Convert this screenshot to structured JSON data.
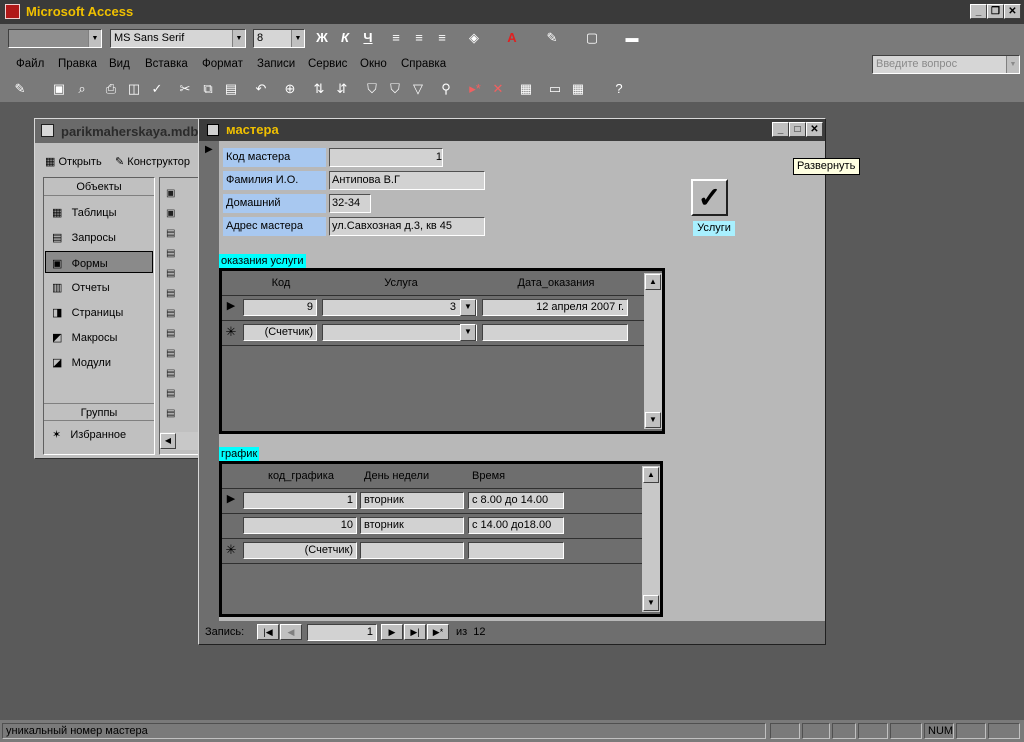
{
  "app": {
    "title": "Microsoft Access"
  },
  "format_toolbar": {
    "object_select": "",
    "font_name": "MS Sans Serif",
    "font_size": "8",
    "bold": "Ж",
    "italic": "К",
    "underline": "Ч"
  },
  "menu": {
    "items": [
      "Файл",
      "Правка",
      "Вид",
      "Вставка",
      "Формат",
      "Записи",
      "Сервис",
      "Окно",
      "Справка"
    ],
    "help_placeholder": "Введите вопрос"
  },
  "db_window": {
    "title": "parikmaherskaya.mdb",
    "open": "Открыть",
    "design": "Конструктор",
    "objects_header": "Объекты",
    "objects": [
      "Таблицы",
      "Запросы",
      "Формы",
      "Отчеты",
      "Страницы",
      "Макросы",
      "Модули"
    ],
    "selected": "Формы",
    "groups_header": "Группы",
    "groups": [
      "Избранное"
    ]
  },
  "form": {
    "title": "мастера",
    "fields": [
      {
        "label": "Код мастера",
        "value": "1"
      },
      {
        "label": "Фамилия И.О.",
        "value": "Антипова  В.Г"
      },
      {
        "label": "Домашний телофон",
        "value": "32-34"
      },
      {
        "label": "Адрес мастера",
        "value": "ул.Савхозная д.3, кв 45"
      }
    ],
    "button_label": "Услуги",
    "tooltip": "Развернуть",
    "subform1": {
      "label": "оказания услуги",
      "headers": [
        "Код",
        "Услуга",
        "Дата_оказания"
      ],
      "rows": [
        {
          "code": "9",
          "service": "3",
          "date": "12 апреля 2007 г."
        }
      ],
      "new_row_code": "(Счетчик)"
    },
    "subform2": {
      "label": "график",
      "headers": [
        "код_графика",
        "День недели",
        "Время"
      ],
      "rows": [
        {
          "code": "1",
          "day": "вторник",
          "time": "с 8.00 до 14.00"
        },
        {
          "code": "10",
          "day": "вторник",
          "time": "с 14.00 до18.00"
        }
      ],
      "new_row_code": "(Счетчик)"
    },
    "nav": {
      "label": "Запись:",
      "current": "1",
      "of": "из  12"
    }
  },
  "status": {
    "text": "уникальный номер мастера",
    "num": "NUM"
  }
}
